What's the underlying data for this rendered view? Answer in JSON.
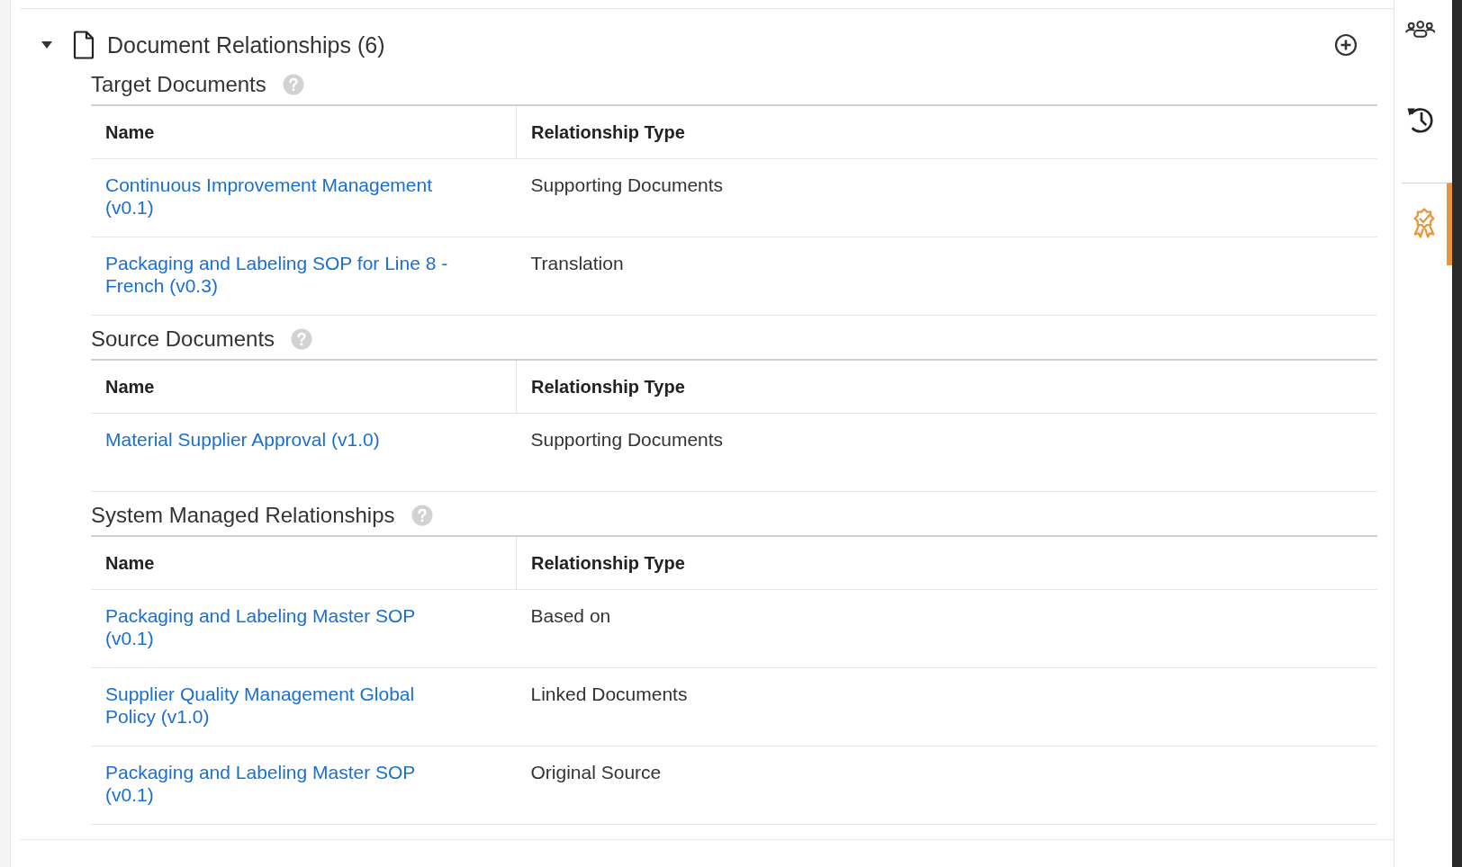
{
  "section": {
    "title": "Document Relationships (6)",
    "expanded": true
  },
  "groups": [
    {
      "title": "Target Documents",
      "columns": [
        "Name",
        "Relationship Type"
      ],
      "rows": [
        {
          "name": "Continuous Improvement Management (v0.1)",
          "type": "Supporting Documents"
        },
        {
          "name": "Packaging and Labeling SOP for Line 8 - French (v0.3)",
          "type": "Translation"
        }
      ]
    },
    {
      "title": "Source Documents",
      "columns": [
        "Name",
        "Relationship Type"
      ],
      "rows": [
        {
          "name": "Material Supplier Approval (v1.0)",
          "type": "Supporting Documents"
        }
      ]
    },
    {
      "title": "System Managed Relationships",
      "columns": [
        "Name",
        "Relationship Type"
      ],
      "rows": [
        {
          "name": "Packaging and Labeling Master SOP (v0.1)",
          "type": "Based on"
        },
        {
          "name": "Supplier Quality Management Global Policy (v1.0)",
          "type": "Linked Documents"
        },
        {
          "name": "Packaging and Labeling Master SOP (v0.1)",
          "type": "Original Source"
        }
      ]
    }
  ],
  "sidebar": {
    "items": [
      {
        "kind": "people",
        "selected": false
      },
      {
        "kind": "history",
        "selected": false
      },
      {
        "kind": "award",
        "selected": true
      }
    ]
  }
}
